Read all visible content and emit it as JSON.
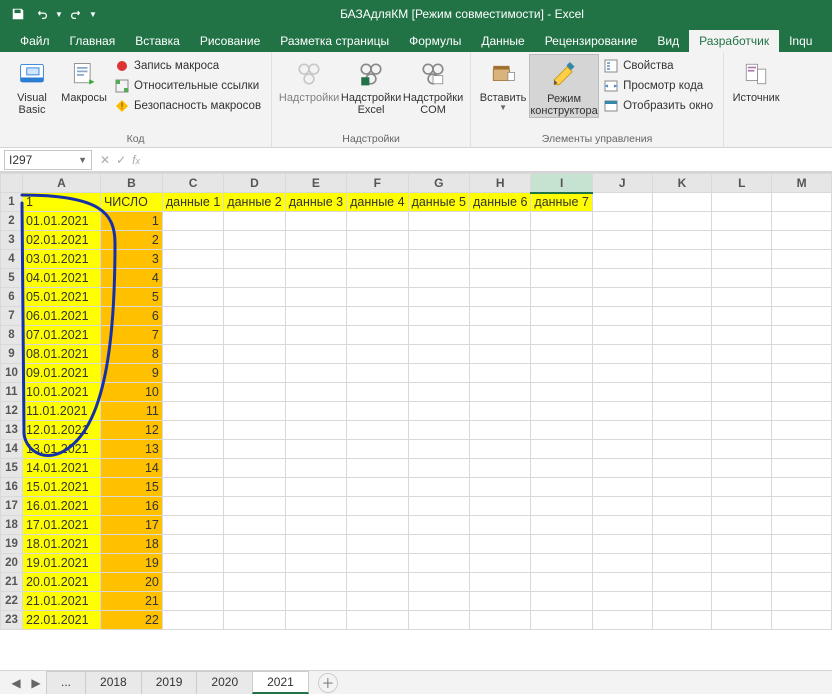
{
  "title": "БАЗАдляКМ  [Режим совместимости]  -  Excel",
  "quick_access": {
    "save": "💾",
    "undo": "↶",
    "redo": "↷"
  },
  "tabs": [
    "Файл",
    "Главная",
    "Вставка",
    "Рисование",
    "Разметка страницы",
    "Формулы",
    "Данные",
    "Рецензирование",
    "Вид",
    "Разработчик",
    "Inqu"
  ],
  "active_tab": "Разработчик",
  "ribbon": {
    "visual_basic": "Visual\nBasic",
    "macros": "Макросы",
    "record_macro": "Запись макроса",
    "relative_refs": "Относительные ссылки",
    "macro_security": "Безопасность макросов",
    "group_code": "Код",
    "addins": "Надстройки",
    "excel_addins": "Надстройки\nExcel",
    "com_addins": "Надстройки\nCOM",
    "group_addins": "Надстройки",
    "insert": "Вставить",
    "design_mode": "Режим\nконструктора",
    "properties": "Свойства",
    "view_code": "Просмотр кода",
    "run_dialog": "Отобразить окно",
    "group_controls": "Элементы управления",
    "source": "Источник"
  },
  "name_box": "I297",
  "formula_bar": "",
  "columns": [
    "A",
    "B",
    "C",
    "D",
    "E",
    "F",
    "G",
    "H",
    "I",
    "J",
    "K",
    "L",
    "M"
  ],
  "active_col_index": 8,
  "header_row": {
    "A": "1",
    "B": "ЧИСЛО",
    "C": "данные 1",
    "D": "данные 2",
    "E": "данные 3",
    "F": "данные 4",
    "G": "данные 5",
    "H": "данные 6",
    "I": "данные 7"
  },
  "rows": [
    {
      "n": 2,
      "A": "01.01.2021",
      "B": "1"
    },
    {
      "n": 3,
      "A": "02.01.2021",
      "B": "2"
    },
    {
      "n": 4,
      "A": "03.01.2021",
      "B": "3"
    },
    {
      "n": 5,
      "A": "04.01.2021",
      "B": "4"
    },
    {
      "n": 6,
      "A": "05.01.2021",
      "B": "5"
    },
    {
      "n": 7,
      "A": "06.01.2021",
      "B": "6"
    },
    {
      "n": 8,
      "A": "07.01.2021",
      "B": "7"
    },
    {
      "n": 9,
      "A": "08.01.2021",
      "B": "8"
    },
    {
      "n": 10,
      "A": "09.01.2021",
      "B": "9"
    },
    {
      "n": 11,
      "A": "10.01.2021",
      "B": "10"
    },
    {
      "n": 12,
      "A": "11.01.2021",
      "B": "11"
    },
    {
      "n": 13,
      "A": "12.01.2021",
      "B": "12"
    },
    {
      "n": 14,
      "A": "13.01.2021",
      "B": "13"
    },
    {
      "n": 15,
      "A": "14.01.2021",
      "B": "14"
    },
    {
      "n": 16,
      "A": "15.01.2021",
      "B": "15"
    },
    {
      "n": 17,
      "A": "16.01.2021",
      "B": "16"
    },
    {
      "n": 18,
      "A": "17.01.2021",
      "B": "17"
    },
    {
      "n": 19,
      "A": "18.01.2021",
      "B": "18"
    },
    {
      "n": 20,
      "A": "19.01.2021",
      "B": "19"
    },
    {
      "n": 21,
      "A": "20.01.2021",
      "B": "20"
    },
    {
      "n": 22,
      "A": "21.01.2021",
      "B": "21"
    },
    {
      "n": 23,
      "A": "22.01.2021",
      "B": "22"
    }
  ],
  "sheets": [
    "...",
    "2018",
    "2019",
    "2020",
    "2021"
  ],
  "active_sheet": "2021"
}
